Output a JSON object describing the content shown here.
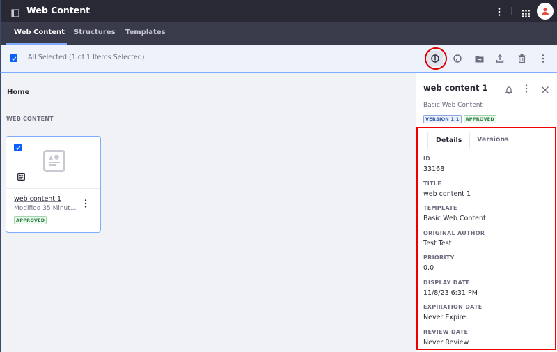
{
  "appbar": {
    "title": "Web Content",
    "avatar_color": "#e54d43"
  },
  "nav": {
    "tabs": [
      {
        "label": "Web Content",
        "active": true
      },
      {
        "label": "Structures",
        "active": false
      },
      {
        "label": "Templates",
        "active": false
      }
    ]
  },
  "toolbar": {
    "selection_text": "All Selected (1 of 1 Items Selected)",
    "checked": true,
    "actions": [
      "info-icon",
      "clock-icon",
      "move-folder-icon",
      "upload-icon",
      "trash-icon",
      "kebab-icon"
    ]
  },
  "main": {
    "breadcrumb": "Home",
    "section_label": "WEB CONTENT",
    "card": {
      "title": "web content 1",
      "meta": "Modified 35 Minut...",
      "status": "APPROVED",
      "checked": true
    }
  },
  "sidebar": {
    "title": "web content 1",
    "subtitle": "Basic Web Content",
    "version_label": "VERSION 1.1",
    "status_label": "APPROVED",
    "tabs": [
      {
        "label": "Details",
        "active": true
      },
      {
        "label": "Versions",
        "active": false
      }
    ],
    "fields": [
      {
        "key": "ID",
        "value": "33168"
      },
      {
        "key": "TITLE",
        "value": "web content 1"
      },
      {
        "key": "TEMPLATE",
        "value": "Basic Web Content"
      },
      {
        "key": "ORIGINAL AUTHOR",
        "value": "Test Test"
      },
      {
        "key": "PRIORITY",
        "value": "0.0"
      },
      {
        "key": "DISPLAY DATE",
        "value": "11/8/23 6:31 PM"
      },
      {
        "key": "EXPIRATION DATE",
        "value": "Never Expire"
      },
      {
        "key": "REVIEW DATE",
        "value": "Never Review"
      }
    ]
  },
  "colors": {
    "accent": "#0b5fff",
    "highlight": "#ee0000",
    "approved": "#287d3c",
    "version": "#2e5aac"
  }
}
